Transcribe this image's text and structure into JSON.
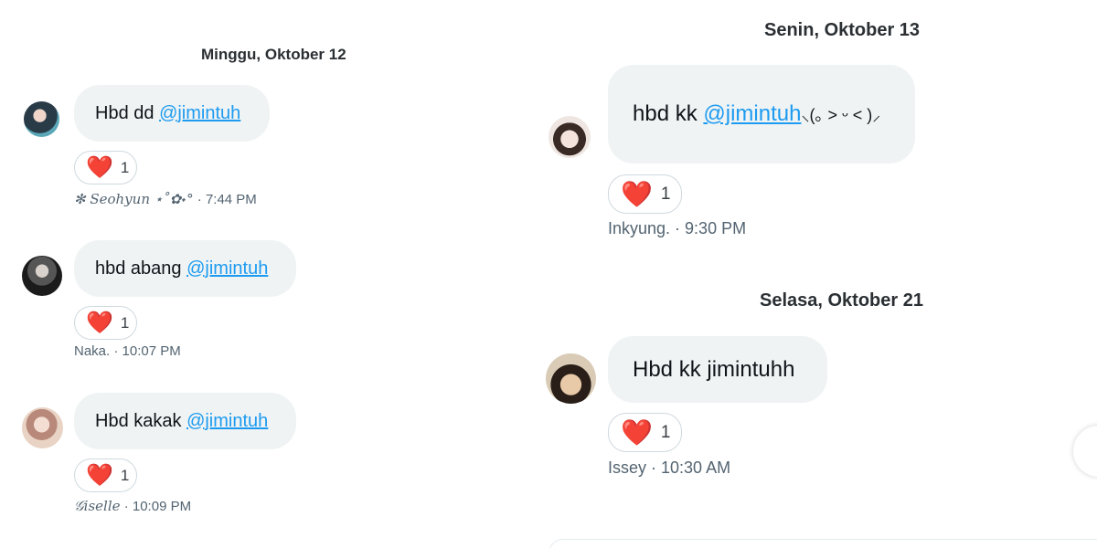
{
  "left_thread": {
    "date": "Minggu, Oktober 12",
    "messages": [
      {
        "text": "Hbd dd ",
        "mention": "@jimintuh",
        "reaction": {
          "emoji": "❤️",
          "count": "1"
        },
        "author": "✻ Seohyun ⋆˚✿˖°",
        "time": "7:44 PM",
        "avatar_color": "#3c6f86"
      },
      {
        "text": "hbd abang ",
        "mention": "@jimintuh",
        "reaction": {
          "emoji": "❤️",
          "count": "1"
        },
        "author": "Naka.",
        "time": "10:07 PM",
        "avatar_color": "#2d2d2d"
      },
      {
        "text": "Hbd kakak ",
        "mention": "@jimintuh",
        "reaction": {
          "emoji": "❤️",
          "count": "1"
        },
        "author": "𝒢iselle",
        "time": "10:09 PM",
        "avatar_color": "#c9a58a"
      }
    ]
  },
  "right_thread": {
    "groups": [
      {
        "date": "Senin, Oktober 13",
        "text": "hbd kk ",
        "mention": "@jimintuh",
        "suffix": " ⸜(｡ ˃ ᵕ ˂ )⸝",
        "reaction": {
          "emoji": "❤️",
          "count": "1"
        },
        "author": "Inkyung.",
        "time": "9:30 PM",
        "avatar_color": "#e9dcd6"
      },
      {
        "date": "Selasa, Oktober 21",
        "text": "Hbd kk jimintuhh",
        "mention": "",
        "suffix": "",
        "reaction": {
          "emoji": "❤️",
          "count": "1"
        },
        "author": "Issey",
        "time": "10:30 AM",
        "avatar_color": "#3b2f25"
      }
    ]
  },
  "separator": " · ",
  "colors": {
    "bubble": "#eff3f4",
    "mention": "#1d9bf0",
    "meta": "#536471",
    "reaction_border": "#cfd9de"
  }
}
